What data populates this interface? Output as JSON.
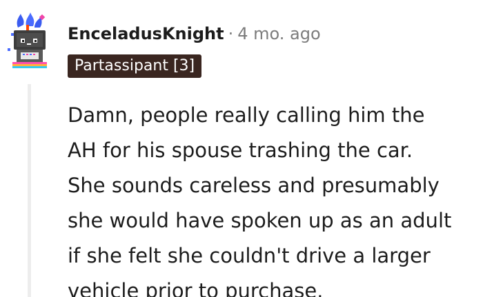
{
  "author": {
    "username": "EnceladusKnight",
    "separator": "·",
    "timestamp": "4 mo. ago",
    "flair": "Partassipant [3]",
    "avatar": "robot-avatar-icon"
  },
  "comment": {
    "lines": [
      "Damn, people really calling him the",
      "AH for his spouse trashing the car.",
      "She sounds careless and presumably",
      "she would have spoken up as an adult",
      "if she felt she couldn't drive a larger",
      "vehicle prior to purchase."
    ]
  },
  "colors": {
    "flair_bg": "#3a2620",
    "text": "#1c1c1c",
    "meta": "#7c7c7c",
    "thread_line": "#ededed"
  }
}
